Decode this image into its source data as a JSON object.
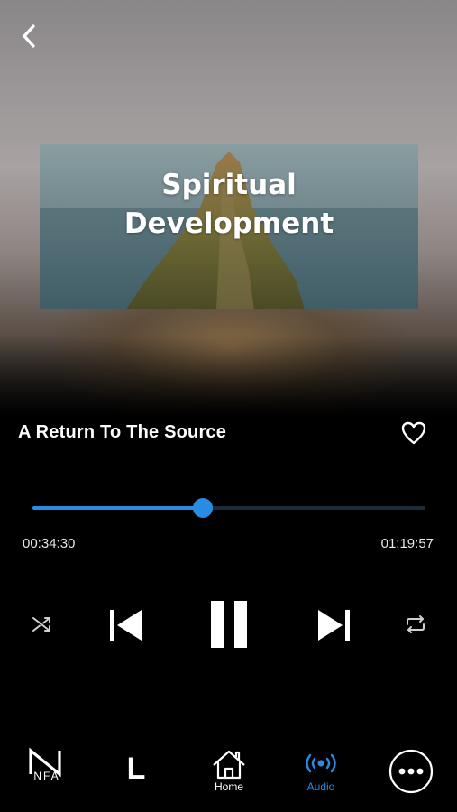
{
  "header": {
    "back_icon": "chevron-left-icon"
  },
  "cover": {
    "title_line1": "Spiritual",
    "title_line2": "Development"
  },
  "track": {
    "title": "A Return To The Source",
    "favorite_icon": "heart-outline-icon"
  },
  "player": {
    "elapsed": "00:34:30",
    "duration": "01:19:57",
    "progress_fraction": 0.433,
    "accent_color": "#2a8be3",
    "state": "playing"
  },
  "controls": [
    {
      "name": "shuffle",
      "icon": "shuffle-icon"
    },
    {
      "name": "previous",
      "icon": "skip-previous-icon"
    },
    {
      "name": "pause",
      "icon": "pause-icon"
    },
    {
      "name": "next",
      "icon": "skip-next-icon"
    },
    {
      "name": "repeat",
      "icon": "repeat-icon"
    }
  ],
  "tabbar": {
    "nfa_label": "NFA",
    "l_label": "L",
    "home_label": "Home",
    "audio_label": "Audio",
    "more_icon": "more-horizontal-icon",
    "active_tab": "Audio",
    "active_color": "#2a8be3"
  }
}
